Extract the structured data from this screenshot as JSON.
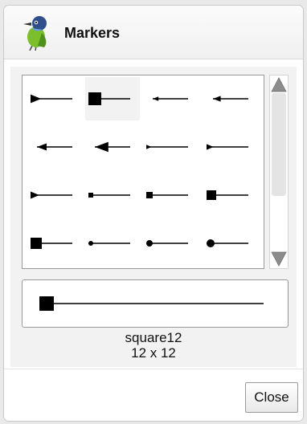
{
  "window": {
    "title": "Markers"
  },
  "markers": [
    {
      "shape": "arrow-right",
      "size": 12
    },
    {
      "shape": "square",
      "size": 16
    },
    {
      "shape": "arrow-left",
      "size": 6
    },
    {
      "shape": "arrow-left",
      "size": 8
    },
    {
      "shape": "arrow-left",
      "size": 10
    },
    {
      "shape": "arrow-left",
      "size": 14
    },
    {
      "shape": "arrow-right",
      "size": 6
    },
    {
      "shape": "arrow-right",
      "size": 8
    },
    {
      "shape": "arrow-right",
      "size": 10
    },
    {
      "shape": "square",
      "size": 6
    },
    {
      "shape": "square",
      "size": 8
    },
    {
      "shape": "square",
      "size": 12
    },
    {
      "shape": "square",
      "size": 14
    },
    {
      "shape": "circle",
      "size": 6
    },
    {
      "shape": "circle",
      "size": 8
    },
    {
      "shape": "circle",
      "size": 10
    }
  ],
  "selected_index": 1,
  "preview": {
    "name": "square12",
    "dimensions": "12 x 12"
  },
  "buttons": {
    "close_label": "Close"
  },
  "colors": {
    "scroll_arrow": "#8c8c8c",
    "thumb": "#e4e4e4"
  }
}
